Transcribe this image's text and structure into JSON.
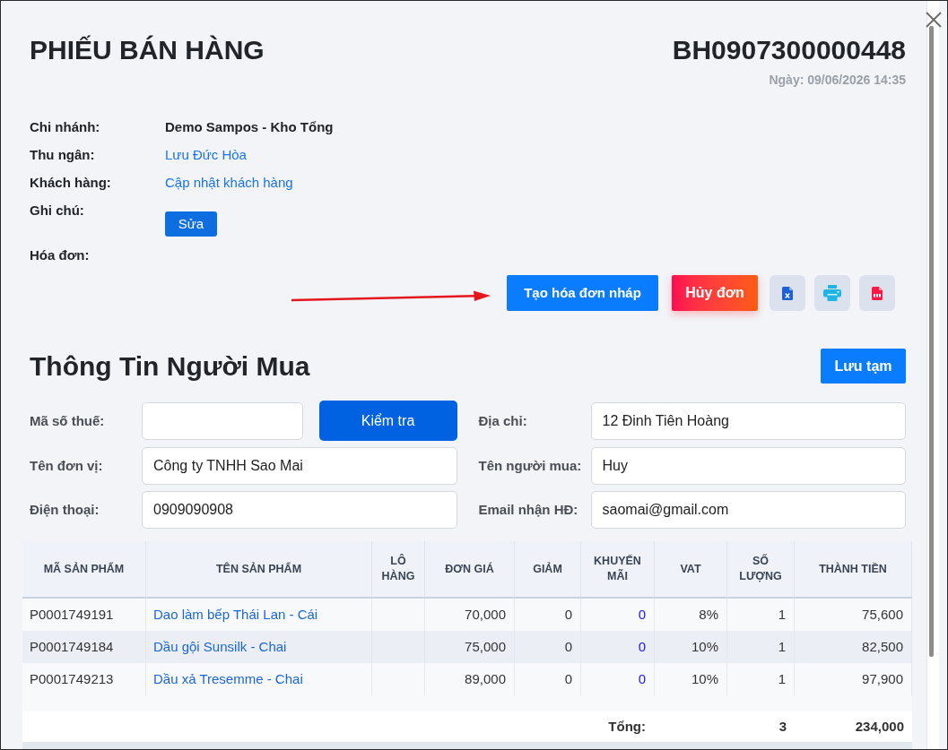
{
  "header": {
    "title": "PHIẾU BÁN HÀNG",
    "code": "BH0907300000448",
    "date": "Ngày: 09/06/2026 14:35"
  },
  "details": [
    {
      "label": "Chi nhánh:",
      "kind": "text",
      "value": "Demo Sampos - Kho Tổng"
    },
    {
      "label": "Thu ngân:",
      "kind": "link",
      "value": "Lưu Đức Hòa"
    },
    {
      "label": "Khách hàng:",
      "kind": "link",
      "value": "Cập nhật khách hàng"
    },
    {
      "label": "Ghi chú:",
      "kind": "button",
      "value": "Sửa"
    },
    {
      "label": "Hóa đơn:",
      "kind": "empty"
    }
  ],
  "actions": {
    "draft_button": "Tạo hóa đơn nháp",
    "cancel_button": "Hủy đơn"
  },
  "buyer": {
    "title": "Thông Tin Người Mua",
    "save_button": "Lưu tạm",
    "fields": [
      {
        "label": "Mã số thuế:",
        "kind": "check",
        "button": "Kiểm tra"
      },
      {
        "label": "Địa chỉ:",
        "kind": "input",
        "value": "12 Đinh Tiên Hoàng"
      },
      {
        "label": "Tên đơn vị:",
        "kind": "input",
        "value": "Công ty TNHH Sao Mai"
      },
      {
        "label": "Tên người mua:",
        "kind": "input",
        "value": "Huy"
      },
      {
        "label": "Điện thoại:",
        "kind": "input",
        "value": "0909090908"
      },
      {
        "label": "Email nhận HĐ:",
        "kind": "input",
        "value": "saomai@gmail.com"
      }
    ]
  },
  "table": {
    "columns": [
      "MÃ SẢN PHẨM",
      "TÊN SẢN PHẨM",
      "LÔ HÀNG",
      "ĐƠN GIÁ",
      "GIẢM",
      "KHUYẾN MÃI",
      "VAT",
      "SỐ LƯỢNG",
      "THÀNH TIỀN"
    ],
    "rows": [
      {
        "code": "P0001749191",
        "name": "Dao làm bếp Thái Lan - Cái",
        "unit_price": "70,000",
        "discount": "0",
        "promotion": "0",
        "vat": "8%",
        "quantity": "1",
        "amount": "75,600"
      },
      {
        "code": "P0001749184",
        "name": "Dầu gội Sunsilk - Chai",
        "unit_price": "75,000",
        "discount": "0",
        "promotion": "0",
        "vat": "10%",
        "quantity": "1",
        "amount": "82,500"
      },
      {
        "code": "P0001749213",
        "name": "Dầu xả Tresemme - Chai",
        "unit_price": "89,000",
        "discount": "0",
        "promotion": "0",
        "vat": "10%",
        "quantity": "1",
        "amount": "97,900"
      }
    ],
    "total": {
      "label": "Tổng:",
      "quantity": "3",
      "amount": "234,000"
    }
  }
}
